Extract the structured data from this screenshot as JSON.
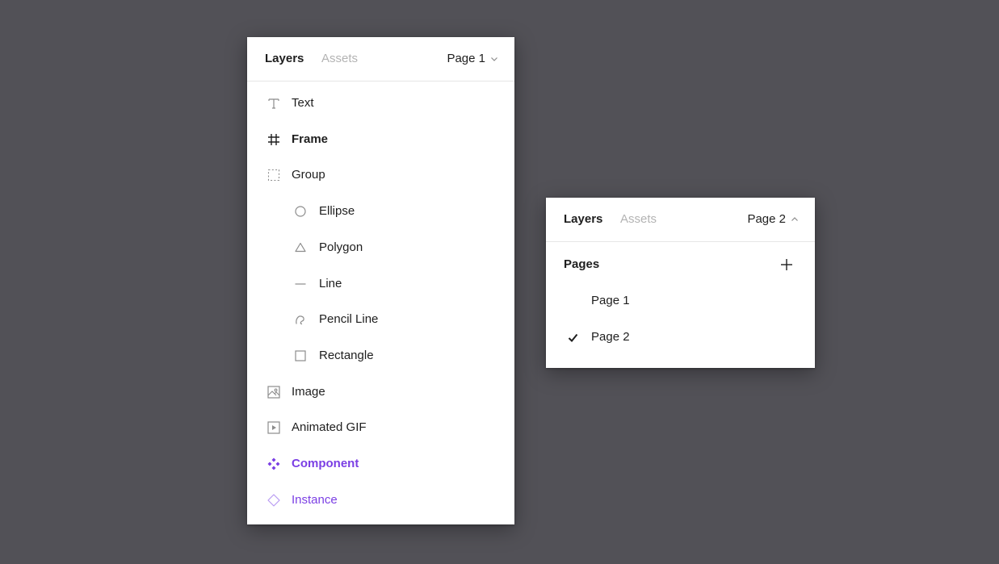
{
  "left_panel": {
    "tabs": {
      "layers": "Layers",
      "assets": "Assets"
    },
    "page_selector": {
      "label": "Page 1",
      "icon": "chevron-down-icon"
    },
    "layers": [
      {
        "label": "Text",
        "icon": "text-icon",
        "indent": 0,
        "style": "normal"
      },
      {
        "label": "Frame",
        "icon": "frame-icon",
        "indent": 0,
        "style": "bold"
      },
      {
        "label": "Group",
        "icon": "group-icon",
        "indent": 0,
        "style": "normal"
      },
      {
        "label": "Ellipse",
        "icon": "ellipse-icon",
        "indent": 1,
        "style": "normal"
      },
      {
        "label": "Polygon",
        "icon": "polygon-icon",
        "indent": 1,
        "style": "normal"
      },
      {
        "label": "Line",
        "icon": "line-icon",
        "indent": 1,
        "style": "normal"
      },
      {
        "label": "Pencil Line",
        "icon": "pencil-line-icon",
        "indent": 1,
        "style": "normal"
      },
      {
        "label": "Rectangle",
        "icon": "rectangle-icon",
        "indent": 1,
        "style": "normal"
      },
      {
        "label": "Image",
        "icon": "image-icon",
        "indent": 0,
        "style": "normal"
      },
      {
        "label": "Animated GIF",
        "icon": "animated-gif-icon",
        "indent": 0,
        "style": "normal"
      },
      {
        "label": "Component",
        "icon": "component-icon",
        "indent": 0,
        "style": "component"
      },
      {
        "label": "Instance",
        "icon": "instance-icon",
        "indent": 0,
        "style": "instance"
      }
    ]
  },
  "right_panel": {
    "tabs": {
      "layers": "Layers",
      "assets": "Assets"
    },
    "page_selector": {
      "label": "Page 2",
      "icon": "chevron-up-icon"
    },
    "pages_title": "Pages",
    "add_icon": "plus-icon",
    "pages": [
      {
        "label": "Page 1",
        "selected": false
      },
      {
        "label": "Page 2",
        "selected": true
      }
    ]
  },
  "colors": {
    "background": "#525157",
    "panel": "#ffffff",
    "text": "#1e1e1e",
    "muted": "#b3b3b3",
    "icon_gray": "#8c8c8c",
    "component_purple": "#7b3fe4",
    "instance_purple": "#b99bf2"
  }
}
